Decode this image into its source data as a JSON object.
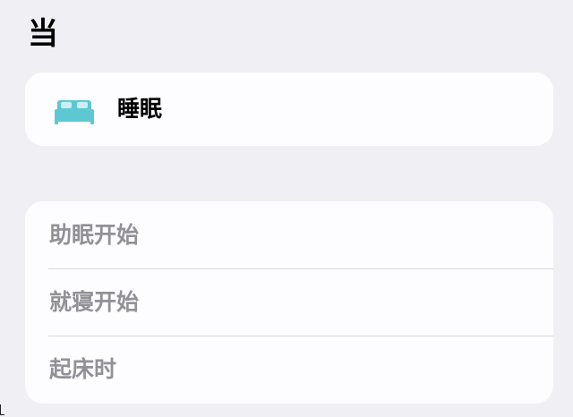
{
  "header": {
    "title": "当"
  },
  "sleep_card": {
    "icon": "bed-icon",
    "icon_color": "#5ec8d2",
    "label": "睡眠"
  },
  "options": [
    {
      "label": "助眠开始"
    },
    {
      "label": "就寝开始"
    },
    {
      "label": "起床时"
    }
  ],
  "colors": {
    "background": "#f0eff4",
    "card": "#fdfcfe",
    "option_text": "#929197",
    "divider": "#d8d7dd"
  }
}
